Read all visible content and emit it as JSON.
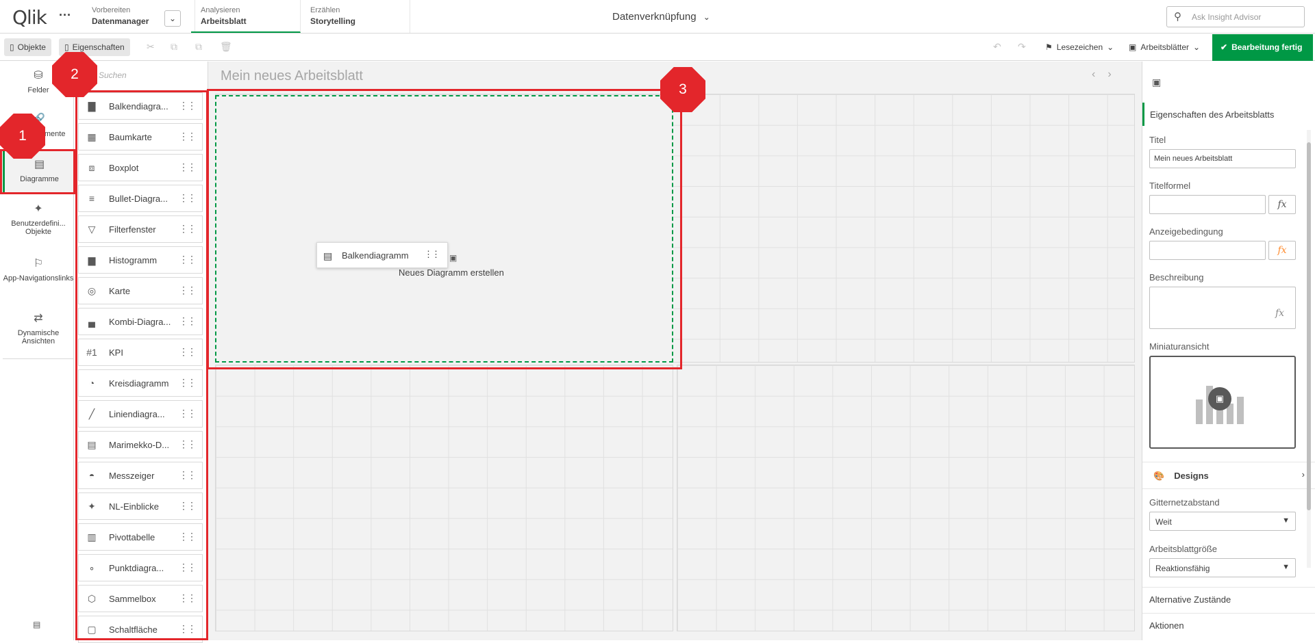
{
  "topbar": {
    "logo": "Qlik",
    "menu_icon": "more-dots-icon",
    "tabs": [
      {
        "small": "Vorbereiten",
        "big": "Datenmanager"
      },
      {
        "small": "Analysieren",
        "big": "Arbeitsblatt"
      },
      {
        "small": "Erzählen",
        "big": "Storytelling"
      }
    ],
    "center_title": "Datenverknüpfung",
    "insight_placeholder": "Ask Insight Advisor"
  },
  "toolbar": {
    "objects_label": "Objekte",
    "properties_label": "Eigenschaften",
    "bookmarks_label": "Lesezeichen",
    "sheets_label": "Arbeitsblätter",
    "done_label": "Bearbeitung fertig"
  },
  "leftnav": {
    "items": [
      {
        "label": "Felder",
        "icon": "database-icon"
      },
      {
        "label": "Masterelemente",
        "icon": "link-icon"
      },
      {
        "label": "Diagramme",
        "icon": "chart-icon"
      },
      {
        "label": "Benutzerdefini... Objekte",
        "icon": "puzzle-icon"
      },
      {
        "label": "App-Navigationslinks",
        "icon": "signpost-icon"
      },
      {
        "label": "Dynamische Ansichten",
        "icon": "refresh-list-icon"
      }
    ]
  },
  "assets": {
    "search_placeholder": "Suchen",
    "items": [
      {
        "label": "Balkendiagra...",
        "icon": "bar-chart-icon"
      },
      {
        "label": "Baumkarte",
        "icon": "treemap-icon"
      },
      {
        "label": "Boxplot",
        "icon": "boxplot-icon"
      },
      {
        "label": "Bullet-Diagra...",
        "icon": "bullet-chart-icon"
      },
      {
        "label": "Filterfenster",
        "icon": "filter-icon"
      },
      {
        "label": "Histogramm",
        "icon": "histogram-icon"
      },
      {
        "label": "Karte",
        "icon": "globe-icon"
      },
      {
        "label": "Kombi-Diagra...",
        "icon": "combo-chart-icon"
      },
      {
        "label": "KPI",
        "icon": "kpi-icon"
      },
      {
        "label": "Kreisdiagramm",
        "icon": "pie-chart-icon"
      },
      {
        "label": "Liniendiagra...",
        "icon": "line-chart-icon"
      },
      {
        "label": "Marimekko-D...",
        "icon": "marimekko-icon"
      },
      {
        "label": "Messzeiger",
        "icon": "gauge-icon"
      },
      {
        "label": "NL-Einblicke",
        "icon": "nl-insights-icon"
      },
      {
        "label": "Pivottabelle",
        "icon": "pivot-table-icon"
      },
      {
        "label": "Punktdiagra...",
        "icon": "scatter-icon"
      },
      {
        "label": "Sammelbox",
        "icon": "box-icon"
      },
      {
        "label": "Schaltfläche",
        "icon": "button-icon"
      }
    ]
  },
  "canvas": {
    "sheet_title": "Mein neues Arbeitsblatt",
    "drop_text": "Neues Diagramm erstellen",
    "drag_label": "Balkendiagramm"
  },
  "props": {
    "header": "Eigenschaften des Arbeitsblatts",
    "title_label": "Titel",
    "title_value": "Mein neues Arbeitsblatt",
    "title_formula_label": "Titelformel",
    "show_condition_label": "Anzeigebedingung",
    "description_label": "Beschreibung",
    "thumbnail_label": "Miniaturansicht",
    "designs_label": "Designs",
    "grid_spacing_label": "Gitternetzabstand",
    "grid_spacing_value": "Weit",
    "sheet_size_label": "Arbeitsblattgröße",
    "sheet_size_value": "Reaktionsfähig",
    "alt_states_label": "Alternative Zustände",
    "actions_label": "Aktionen"
  },
  "annotations": [
    "1",
    "2",
    "3"
  ],
  "colors": {
    "accent": "#009845",
    "annotation": "#e3262b"
  }
}
